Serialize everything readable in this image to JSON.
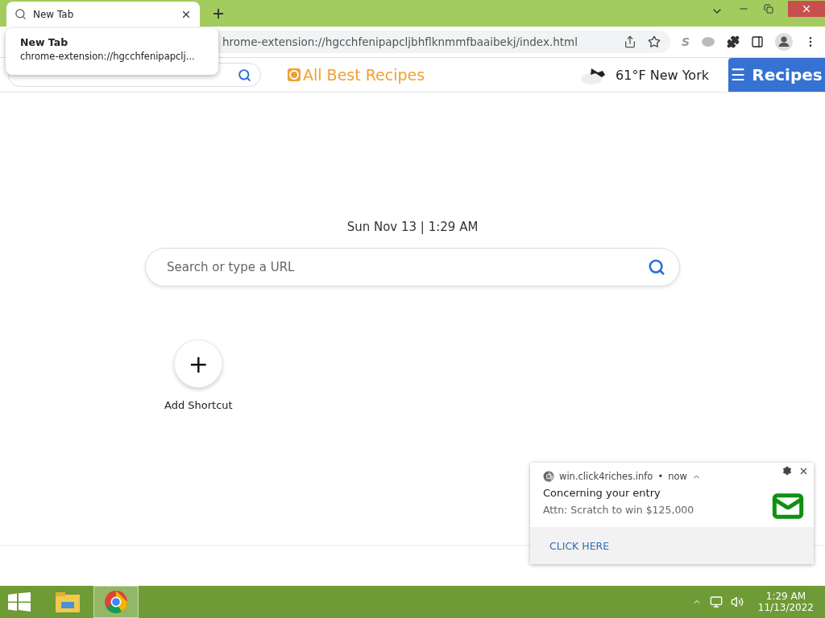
{
  "tab": {
    "title": "New Tab",
    "selected": true
  },
  "tooltip": {
    "title": "New Tab",
    "url": "chrome-extension://hgcchfenipapclj..."
  },
  "address": {
    "value": "hrome-extension://hgcchfenipapcljbhflknmmfbaaibekj/index.html"
  },
  "extension_letter": "S",
  "header": {
    "brand": "All Best Recipes",
    "weather": "61°F New York",
    "menu_icon": "☰",
    "menu_label": "Recipes"
  },
  "datetime": "Sun Nov 13 | 1:29 AM",
  "main_search": {
    "placeholder": "Search or type a URL"
  },
  "shortcut": {
    "icon": "+",
    "label": "Add Shortcut"
  },
  "notification": {
    "site": "win.click4riches.info",
    "separator": "•",
    "time": "now",
    "title": "Concerning your entry",
    "body": "Attn: Scratch to win $125,000",
    "action": "CLICK HERE"
  },
  "taskbar": {
    "apps": [
      {
        "kind": "explorer",
        "selected": false
      },
      {
        "kind": "chrome",
        "selected": true
      }
    ],
    "time": "1:29 AM",
    "date": "11/13/2022"
  }
}
